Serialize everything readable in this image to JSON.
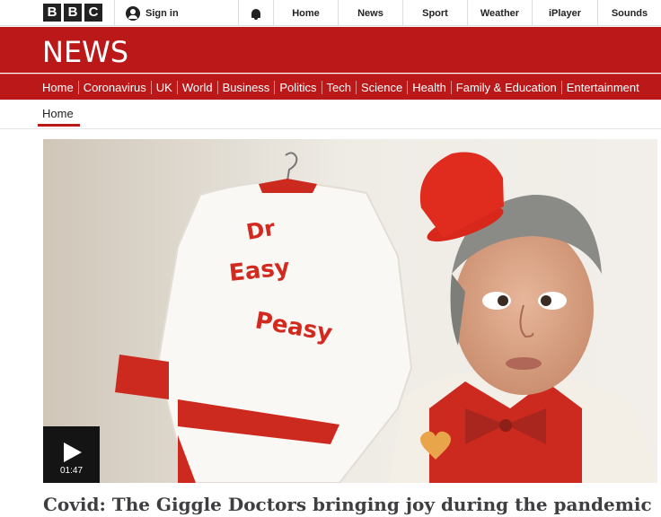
{
  "masthead": {
    "logo_letters": [
      "B",
      "B",
      "C"
    ],
    "sign_in_label": "Sign in",
    "notifications_icon": "bell-icon",
    "nav_links": [
      "Home",
      "News",
      "Sport",
      "Weather",
      "iPlayer",
      "Sounds"
    ]
  },
  "banner": {
    "title": "NEWS"
  },
  "section_nav": {
    "items": [
      "Home",
      "Coronavirus",
      "UK",
      "World",
      "Business",
      "Politics",
      "Tech",
      "Science",
      "Health",
      "Family & Education",
      "Entertainment"
    ]
  },
  "sub_nav": {
    "active_tab": "Home"
  },
  "video": {
    "duration": "01:47",
    "play_icon": "play-icon"
  },
  "article": {
    "headline": "Covid: The Giggle Doctors bringing joy during the pandemic"
  },
  "colors": {
    "brand_red": "#bb1919",
    "play_box": "#141414"
  }
}
